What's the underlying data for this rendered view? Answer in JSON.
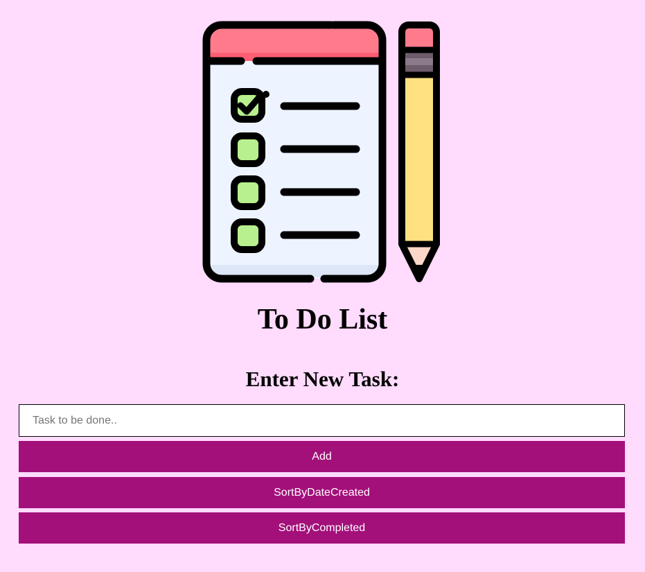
{
  "logo": {
    "icon": "todo-list-clipboard-pencil-icon"
  },
  "header": {
    "title": "To Do List"
  },
  "form": {
    "heading": "Enter New Task:",
    "input_placeholder": "Task to be done..",
    "input_value": "",
    "add_label": "Add",
    "sort_by_date_label": "SortByDateCreated",
    "sort_by_completed_label": "SortByCompleted"
  },
  "colors": {
    "background": "#FFDBFD",
    "button": "#A3107A",
    "button_text": "#FFFFFF"
  }
}
